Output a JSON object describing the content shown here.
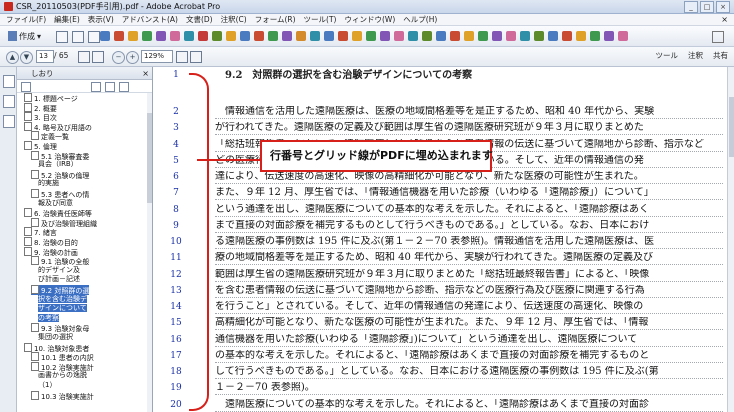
{
  "window": {
    "title": "CSR_20110503(PDF手引用).pdf - Adobe Acrobat Pro",
    "controls": [
      "_",
      "□",
      "×"
    ]
  },
  "menubar": {
    "items": [
      "ファイル(F)",
      "編集(E)",
      "表示(V)",
      "アドバンスト(A)",
      "文書(D)",
      "注釈(C)",
      "フォーム(R)",
      "ツール(T)",
      "ウィンドウ(W)",
      "ヘルプ(H)"
    ],
    "close": "×"
  },
  "toolbar": {
    "create_label": "作成",
    "page_current": "13",
    "page_total": "/ 65",
    "zoom": "129%",
    "panels": [
      "ツール",
      "注釈",
      "共有"
    ]
  },
  "sidepanel": {
    "title": "しおり",
    "close": "×",
    "bookmarks": [
      {
        "label": "1. 標題ページ",
        "indent": 1
      },
      {
        "label": "2. 概要",
        "indent": 1
      },
      {
        "label": "3. 目次",
        "indent": 1
      },
      {
        "label": "4. 略号及び用語の",
        "indent": 1
      },
      {
        "label": "定義一覧",
        "indent": 2
      },
      {
        "label": "5. 倫理",
        "indent": 1
      },
      {
        "label": "5.1 治験審査委",
        "indent": 2
      },
      {
        "label": "員会（IRB）",
        "indent": 3
      },
      {
        "label": "5.2 治験の倫理",
        "indent": 2
      },
      {
        "label": "的実施",
        "indent": 3
      },
      {
        "label": "5.3 患者への情",
        "indent": 2
      },
      {
        "label": "報及び同意",
        "indent": 3
      },
      {
        "label": "6. 治験責任医師等",
        "indent": 1
      },
      {
        "label": "及び治験管理組織",
        "indent": 2
      },
      {
        "label": "7. 緒言",
        "indent": 1
      },
      {
        "label": "8. 治験の目的",
        "indent": 1
      },
      {
        "label": "9. 治験の計画",
        "indent": 1
      },
      {
        "label": "9.1 治験の全般",
        "indent": 2
      },
      {
        "label": "的デザイン及",
        "indent": 3
      },
      {
        "label": "び計画－記述",
        "indent": 3
      },
      {
        "label": "9.2 対照群の選",
        "indent": 2,
        "selected": true
      },
      {
        "label": "択を含む治験デ",
        "indent": 3,
        "selected": true
      },
      {
        "label": "ザインについて",
        "indent": 3,
        "selected": true
      },
      {
        "label": "の考察",
        "indent": 3,
        "selected": true
      },
      {
        "label": "9.3 治験対象母",
        "indent": 2
      },
      {
        "label": "集団の選択",
        "indent": 3
      },
      {
        "label": "10. 治験対象患者",
        "indent": 1
      },
      {
        "label": "10.1 患者の内訳",
        "indent": 2
      },
      {
        "label": "10.2 治験実施計",
        "indent": 2
      },
      {
        "label": "画書からの逸脱",
        "indent": 3
      },
      {
        "label": "（1）",
        "indent": 3
      },
      {
        "label": "10.3 治験実施計",
        "indent": 2
      }
    ]
  },
  "document": {
    "heading": "9.2　対照群の選択を含む治験デザインについての考察",
    "line_numbers": [
      "1",
      "2",
      "3",
      "4",
      "5",
      "6",
      "7",
      "8",
      "9",
      "10",
      "11",
      "12",
      "13",
      "14",
      "15",
      "16",
      "17",
      "18",
      "19",
      "20"
    ],
    "lines": [
      "",
      "　情報通信を活用した遠隔医療は、医療の地域間格差等を是正するため、昭和 40 年代から、実験",
      "が行われてきた。遠隔医療の定義及び範囲は厚生省の遠隔医療研究班が９年３月に取りまとめた",
      "「総括班報告書」において、遠隔医療とは「映像を含む患者情報の伝送に基づいて遠隔地から診断、指示など",
      "どの医療行為及び医療に関連した行為を行うこと」とされている。そして、近年の情報通信の発",
      "達により、伝送速度の高速化、映像の高精細化が可能となり、新たな医療の可能性が生まれた。",
      "また、９年 12 月、厚生省では、「情報通信機器を用いた診療（いわゆる「遠隔診療」）について」",
      "という通達を出し、遠隔医療についての基本的な考えを示した。それによると、「遠隔診療はあく",
      "まで直接の対面診療を補完するものとして行うべきものである。」としている。なお、日本におけ",
      "る遠隔医療の事例数は 195 件に及ぶ(第１－２－70 表参照)。情報通信を活用した遠隔医療は、医",
      "療の地域間格差等を是正するため、昭和 40 年代から、実験が行われてきた。遠隔医療の定義及び",
      "範囲は厚生省の遠隔医療研究班が９年３月に取りまとめた「総括班最終報告書」によると、「映像",
      "を含む患者情報の伝送に基づいて遠隔地から診断、指示などの医療行為及び医療に関連する行為",
      "を行うこと」とされている。そして、近年の情報通信の発達により、伝送速度の高速化、映像の",
      "高精細化が可能となり、新たな医療の可能性が生まれた。また、９年 12 月、厚生省では、「情報",
      "通信機器を用いた診療(いわゆる「遠隔診療」)について」という通達を出し、遠隔医療について",
      "の基本的な考えを示した。それによると、「遠隔診療はあくまで直接の対面診療を補完するものと",
      "して行うべきものである。」としている。なお、日本における遠隔医療の事例数は 195 件に及ぶ(第",
      "１－２－70 表参照)。",
      "　遠隔医療についての基本的な考えを示した。それによると、「遠隔診療はあくまで直接の対面診"
    ]
  },
  "callout": {
    "text": "行番号とグリッド線がPDFに埋め込まれます"
  }
}
